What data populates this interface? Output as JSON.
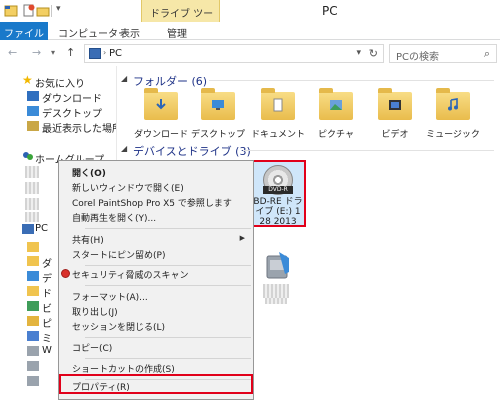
{
  "titlebar": {
    "context_tab": "ドライブ ツール",
    "window_title": "PC"
  },
  "ribbon": {
    "tabs": [
      {
        "label": "ファイル"
      },
      {
        "label": "コンピューター"
      },
      {
        "label": "表示"
      },
      {
        "label": "管理"
      }
    ]
  },
  "address": {
    "path": "PC",
    "search_placeholder": "PCの検索"
  },
  "nav": {
    "favorites": "お気に入り",
    "favorite_items": [
      "ダウンロード",
      "デスクトップ",
      "最近表示した場所"
    ],
    "homegroup": "ホームグループ",
    "pc": "PC",
    "pc_sub_fragments": [
      "ダ",
      "デ",
      "ド",
      "ビ",
      "ピ",
      "ミ",
      "W"
    ]
  },
  "content": {
    "folders_header": "フォルダー (6)",
    "folders": [
      "ダウンロード",
      "デスクトップ",
      "ドキュメント",
      "ピクチャ",
      "ビデオ",
      "ミュージック"
    ],
    "devices_header": "デバイスとドライブ (3)",
    "drive": {
      "badge": "DVD-R",
      "label_lines": [
        "BD-RE ドラ",
        "イブ (E:) 1",
        "28 2013"
      ]
    }
  },
  "context_menu": {
    "items": [
      {
        "label": "開く(O)"
      },
      {
        "label": "新しいウィンドウで開く(E)"
      },
      {
        "label": "Corel PaintShop Pro X5 で参照します"
      },
      {
        "label": "自動再生を開く(Y)..."
      },
      {
        "label": "共有(H)"
      },
      {
        "label": "スタートにピン留め(P)"
      },
      {
        "label": "セキュリティ脅威のスキャン"
      },
      {
        "label": "フォーマット(A)..."
      },
      {
        "label": "取り出し(J)"
      },
      {
        "label": "セッションを閉じる(L)"
      },
      {
        "label": "コピー(C)"
      },
      {
        "label": "ショートカットの作成(S)"
      },
      {
        "label": "プロパティ(R)"
      }
    ]
  },
  "colors": {
    "file_tab": "#1979ca",
    "context_tab": "#f6e7a8",
    "highlight": "#e1001a",
    "section_header": "#1e3287",
    "selected_tile": "#cfe6fa"
  }
}
